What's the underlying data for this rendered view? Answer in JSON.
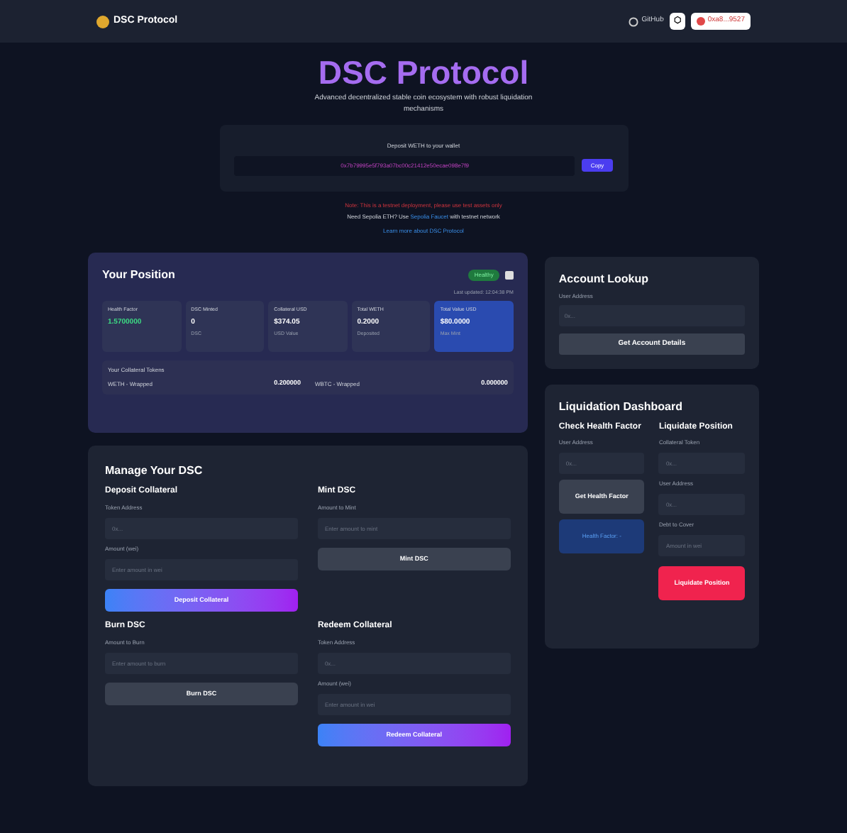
{
  "nav": {
    "brand": "DSC Protocol",
    "github": "GitHub",
    "network": "⬡",
    "account": "0xa8...9527"
  },
  "hero": {
    "title": "DSC Protocol",
    "subtitle": "Advanced decentralized stable coin ecosystem with robust liquidation mechanisms",
    "faucet_label": "Deposit WETH to your wallet",
    "address": "0x7b79995e5f793a07bc00c21412e50ecae098e7f9",
    "copy": "Copy",
    "warning": "Note: This is a testnet deployment, please use test assets only",
    "help_before": "Need Sepolia ETH? Use",
    "help_link": "Sepolia Faucet",
    "help_after": "with testnet network",
    "learn": "Learn more about DSC Protocol"
  },
  "position": {
    "title": "Your Position",
    "status": "Healthy",
    "updated": "Last updated: 12:04:38 PM",
    "stats": [
      {
        "label": "Health Factor",
        "value": "1.5700000",
        "kind": "health"
      },
      {
        "label": "DSC Minted",
        "value": "0",
        "note": "DSC",
        "kind": "plain"
      },
      {
        "label": "Collateral USD",
        "value": "$374.05",
        "note": "USD Value",
        "kind": "plain"
      },
      {
        "label": "Total WETH",
        "value": "0.2000",
        "note": "Deposited",
        "kind": "plain"
      },
      {
        "label": "Total Value USD",
        "value": "$80.0000",
        "note": "Max Mint",
        "kind": "highlight"
      }
    ],
    "breakdown_title": "Your Collateral Tokens",
    "breakdown": [
      {
        "token": "WETH - Wrapped",
        "amount": "0.200000"
      },
      {
        "token": "WBTC - Wrapped",
        "amount": "0.000000"
      }
    ]
  },
  "manage": {
    "title": "Manage Your DSC",
    "sections": [
      {
        "title": "Deposit Collateral",
        "fields": [
          {
            "label": "Token Address",
            "placeholder": "0x..."
          },
          {
            "label": "Amount (wei)",
            "placeholder": "Enter amount in wei"
          }
        ],
        "button": "Deposit Collateral",
        "kind": "gradient"
      },
      {
        "title": "Mint DSC",
        "fields": [
          {
            "label": "Amount to Mint",
            "placeholder": "Enter amount to mint"
          }
        ],
        "button": "Mint DSC",
        "kind": "plain"
      },
      {
        "title": "Burn DSC",
        "fields": [
          {
            "label": "Amount to Burn",
            "placeholder": "Enter amount to burn"
          }
        ],
        "button": "Burn DSC",
        "kind": "plain"
      },
      {
        "title": "Redeem Collateral",
        "fields": [
          {
            "label": "Token Address",
            "placeholder": "0x..."
          },
          {
            "label": "Amount (wei)",
            "placeholder": "Enter amount in wei"
          }
        ],
        "button": "Redeem Collateral",
        "kind": "gradient"
      }
    ]
  },
  "lookup": {
    "title": "Account Lookup",
    "label": "User Address",
    "placeholder": "0x...",
    "button": "Get Account Details"
  },
  "liquidation": {
    "title": "Liquidation Dashboard",
    "check": {
      "title": "Check Health Factor",
      "label": "User Address",
      "placeholder": "0x...",
      "button": "Get Health Factor",
      "result": "Health Factor: -"
    },
    "liquidate": {
      "title": "Liquidate Position",
      "fields": [
        {
          "label": "Collateral Token",
          "placeholder": "0x..."
        },
        {
          "label": "User Address",
          "placeholder": "0x..."
        },
        {
          "label": "Debt to Cover",
          "placeholder": "Amount in wei"
        }
      ],
      "button": "Liquidate Position"
    }
  }
}
